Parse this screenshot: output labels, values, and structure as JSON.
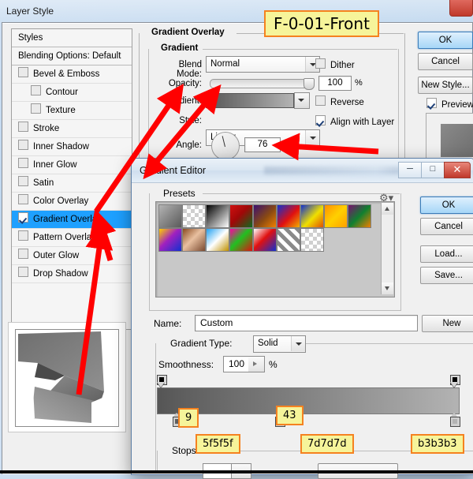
{
  "window": {
    "title": "Layer Style",
    "close_icon": "close-icon"
  },
  "styles_panel": {
    "header": "Styles",
    "blending_options": "Blending Options: Default",
    "items": [
      {
        "label": "Bevel & Emboss",
        "checked": false,
        "indent": false
      },
      {
        "label": "Contour",
        "checked": false,
        "indent": true
      },
      {
        "label": "Texture",
        "checked": false,
        "indent": true
      },
      {
        "label": "Stroke",
        "checked": false,
        "indent": false
      },
      {
        "label": "Inner Shadow",
        "checked": false,
        "indent": false
      },
      {
        "label": "Inner Glow",
        "checked": false,
        "indent": false
      },
      {
        "label": "Satin",
        "checked": false,
        "indent": false
      },
      {
        "label": "Color Overlay",
        "checked": false,
        "indent": false
      },
      {
        "label": "Gradient Overlay",
        "checked": true,
        "indent": false,
        "selected": true
      },
      {
        "label": "Pattern Overlay",
        "checked": false,
        "indent": false
      },
      {
        "label": "Outer Glow",
        "checked": false,
        "indent": false
      },
      {
        "label": "Drop Shadow",
        "checked": false,
        "indent": false
      }
    ]
  },
  "gradient_overlay": {
    "group_title": "Gradient Overlay",
    "sub_group_title": "Gradient",
    "blend_mode_label": "Blend Mode:",
    "blend_mode_value": "Normal",
    "dither_label": "Dither",
    "dither_checked": false,
    "opacity_label": "Opacity:",
    "opacity_value": "100",
    "opacity_unit": "%",
    "gradient_label": "Gradient:",
    "reverse_label": "Reverse",
    "reverse_checked": false,
    "style_label": "Style:",
    "style_value": "Linear",
    "align_with_layer_label": "Align with Layer",
    "align_with_layer_checked": true,
    "angle_label": "Angle:",
    "angle_value": "76",
    "angle_unit": "°"
  },
  "layer_style_buttons": {
    "ok": "OK",
    "cancel": "Cancel",
    "new_style": "New Style...",
    "preview_label": "Preview",
    "preview_checked": true
  },
  "gradient_editor": {
    "title": "Gradient Editor",
    "minimize_glyph": "─",
    "maximize_glyph": "□",
    "close_glyph": "✕",
    "presets_label": "Presets",
    "gear_icon": "gear-icon",
    "buttons": {
      "ok": "OK",
      "cancel": "Cancel",
      "load": "Load...",
      "save": "Save...",
      "new": "New"
    },
    "name_label": "Name:",
    "name_value": "Custom",
    "gradient_type_label": "Gradient Type:",
    "gradient_type_value": "Solid",
    "smoothness_label": "Smoothness:",
    "smoothness_value": "100",
    "smoothness_unit": "%",
    "stops_label": "Stops",
    "presets_swatches": [
      "linear-gradient(135deg,#b4b4b4,#8a8a8a 45%,#5a5a5a)",
      "repeating-conic-gradient(#cfcfcf 0% 25%, #ffffff 0% 50%) 0 0/10px 10px",
      "linear-gradient(135deg,#000000,#ffffff)",
      "linear-gradient(135deg,#d01010,#a00808 45%,#0d6b1e)",
      "linear-gradient(135deg,#3a1070,#8a4a12 55%,#f08000)",
      "linear-gradient(135deg,#1030d0,#e01010 55%,#f0b000)",
      "linear-gradient(135deg,#1030d0,#f0e000 55%,#e05000)",
      "linear-gradient(135deg,#ff9000,#ffd000 50%,#ffa000)",
      "linear-gradient(135deg,#7a1070,#108030 50%,#f08000)",
      "linear-gradient(135deg,#ffd000,#a020c0 45%,#1030d0)",
      "linear-gradient(135deg,#8a4a20,#e8c0a0 45%,#7a4a30)",
      "linear-gradient(135deg,#20a0f0,#ffffff 50%,#c09000)",
      "linear-gradient(135deg,#ff00a0,#20c020 45%,#e01010)",
      "linear-gradient(135deg,#ffffff,#e01010 45%,#1030d0)",
      "repeating-linear-gradient(45deg,#ffffff 0 5px,#8a8a8a 5px 10px)",
      "repeating-conic-gradient(#cfcfcf 0% 25%, #ffffff 0% 50%) 0 0/10px 10px"
    ]
  },
  "annotations": {
    "title_callout": "F-0-01-Front",
    "location_9": "9",
    "location_43": "43",
    "color_stop_1": "5f5f5f",
    "color_stop_2": "7d7d7d",
    "color_stop_3": "b3b3b3"
  }
}
